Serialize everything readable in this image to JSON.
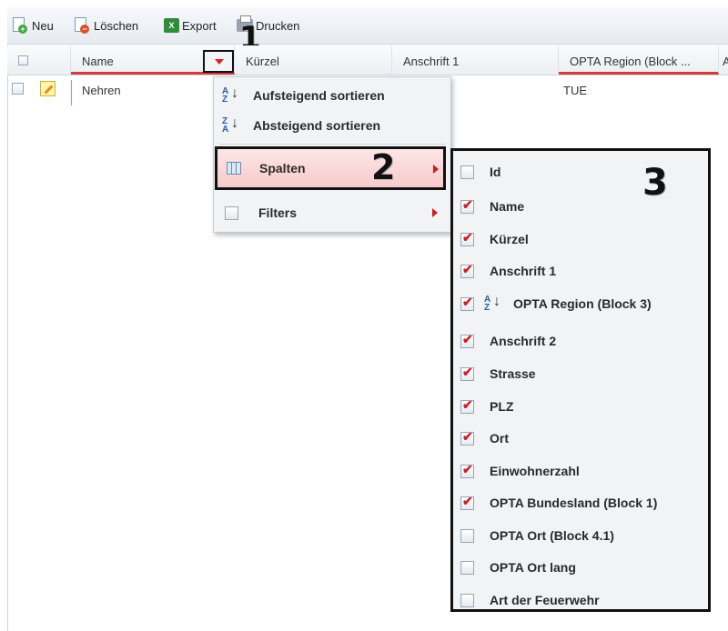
{
  "toolbar": {
    "new_label": "Neu",
    "delete_label": "Löschen",
    "export_label": "Export",
    "print_label": "Drucken"
  },
  "annotations": {
    "one": "1",
    "two": "2",
    "three": "3"
  },
  "grid": {
    "columns": [
      "Name",
      "Kürzel",
      "Anschrift 1",
      "OPTA Region (Block ...",
      "A"
    ],
    "row": {
      "name": "Nehren",
      "opta_region": "TUE"
    }
  },
  "column_menu": {
    "sort_asc": "Aufsteigend sortieren",
    "sort_desc": "Absteigend sortieren",
    "columns": "Spalten",
    "filters": "Filters"
  },
  "column_list": [
    {
      "label": "Id",
      "checked": false
    },
    {
      "label": "Name",
      "checked": true
    },
    {
      "label": "Kürzel",
      "checked": true
    },
    {
      "label": "Anschrift 1",
      "checked": true
    },
    {
      "label": "OPTA Region (Block 3)",
      "checked": true,
      "sorted": true
    },
    {
      "label": "Anschrift 2",
      "checked": true
    },
    {
      "label": "Strasse",
      "checked": true
    },
    {
      "label": "PLZ",
      "checked": true
    },
    {
      "label": "Ort",
      "checked": true
    },
    {
      "label": "Einwohnerzahl",
      "checked": true
    },
    {
      "label": "OPTA Bundesland (Block 1)",
      "checked": true
    },
    {
      "label": "OPTA Ort (Block 4.1)",
      "checked": false
    },
    {
      "label": "OPTA Ort lang",
      "checked": false
    },
    {
      "label": "Art der Feuerwehr",
      "checked": false
    }
  ],
  "colors": {
    "accent_red": "#d21c1c",
    "header_underline": "#d23c3c"
  }
}
